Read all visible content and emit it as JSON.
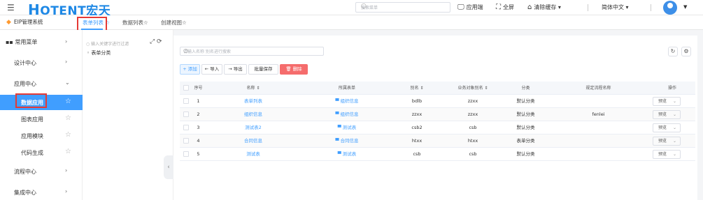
{
  "header": {
    "logo_text": "OTENT宏天",
    "search_placeholder": "搜索菜单",
    "tools": {
      "app": "应用端",
      "fullscreen": "全屏",
      "clear_cache": "清除缓存",
      "language": "简体中文"
    }
  },
  "tabsbar": {
    "system_name": "EIP管理系统",
    "tabs": [
      "表单列表",
      "数据列表",
      "创建视图"
    ]
  },
  "sidebar": {
    "items": [
      {
        "label": "常用菜单"
      },
      {
        "label": "设计中心"
      },
      {
        "label": "应用中心"
      },
      {
        "label": "数据应用"
      },
      {
        "label": "图表应用"
      },
      {
        "label": "应用模块"
      },
      {
        "label": "代码生成"
      },
      {
        "label": "流程中心"
      },
      {
        "label": "集成中心"
      }
    ]
  },
  "tree": {
    "search_placeholder": "输入关键字进行过滤",
    "node": "表单分类"
  },
  "main": {
    "filter_placeholder": "请输入名称 别名进行搜索",
    "buttons": {
      "add": "+ 添加",
      "import": "← 导入",
      "export": "→ 导出",
      "batch_save": "批量保存",
      "delete": "删除"
    },
    "columns": [
      "序号",
      "名称",
      "所属表单",
      "别名",
      "业务对象别名",
      "分类",
      "规定流程名称",
      "操作"
    ],
    "rows": [
      {
        "idx": "1",
        "name": "表单列表",
        "form": "组织信息",
        "alias": "bdlb",
        "bo": "zzxx",
        "category": "默认分类",
        "flow": "",
        "action": "预览"
      },
      {
        "idx": "2",
        "name": "组织信息",
        "form": "组织信息",
        "alias": "zzxx",
        "bo": "zzxx",
        "category": "默认分类",
        "flow": "fenlei",
        "action": "预览"
      },
      {
        "idx": "3",
        "name": "测试表2",
        "form": "测试表",
        "alias": "csb2",
        "bo": "csb",
        "category": "默认分类",
        "flow": "",
        "action": "预览"
      },
      {
        "idx": "4",
        "name": "合同信息",
        "form": "合同信息",
        "alias": "htxx",
        "bo": "htxx",
        "category": "表单分类",
        "flow": "",
        "action": "预览"
      },
      {
        "idx": "5",
        "name": "测试表",
        "form": "测试表",
        "alias": "csb",
        "bo": "csb",
        "category": "默认分类",
        "flow": "",
        "action": "预览"
      }
    ]
  },
  "colors": {
    "accent": "#409eff",
    "danger": "#f56c6c",
    "highlight_box": "#e53935"
  }
}
